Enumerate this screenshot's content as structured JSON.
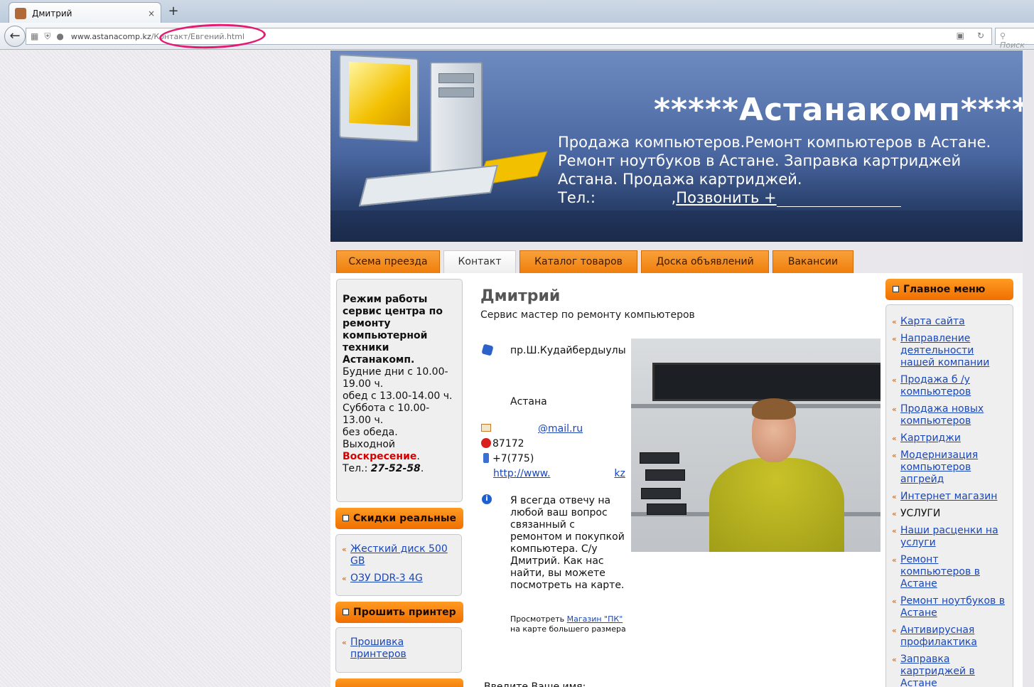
{
  "browser": {
    "tab_title": "Дмитрий",
    "tab_close": "×",
    "new_tab": "+",
    "url_host": "www.astanacomp.kz",
    "url_path": "/Контакт/Евгений.html",
    "search_placeholder": "Поиск"
  },
  "header": {
    "site_title": "*****Астанакомп*****",
    "desc_line1": "Продажа компьютеров.Ремонт компьютеров в Астане.",
    "desc_line2": "Ремонт ноутбуков в Астане. Заправка картриджей",
    "desc_line3": "Астана. Продажа картриджей.",
    "tel_label": "Тел.:",
    "call_link": "Позвонить +"
  },
  "nav": {
    "tabs": [
      {
        "label": "Схема преезда"
      },
      {
        "label": "Контакт"
      },
      {
        "label": "Каталог товаров"
      },
      {
        "label": "Доска объявлений"
      },
      {
        "label": "Вакансии"
      }
    ]
  },
  "left": {
    "hours_title": "Режим работы сервис центра по ремонту компьютерной техники Астанакомп.",
    "weekdays": "Будние дни с 10.00-19.00 ч.",
    "lunch": "обед с 13.00-14.00 ч.",
    "saturday": "Суббота с 10.00-13.00 ч.",
    "no_lunch": "без обеда.",
    "dayoff_label": "Выходной",
    "dayoff_value": "Воскресение",
    "tel_label": "Тел.:",
    "tel_value": "27-52-58",
    "discounts_title": "Скидки реальные",
    "discounts": [
      "Жесткий диск 500 GB",
      "ОЗУ DDR-3 4G"
    ],
    "printer_title": "Прошить принтер",
    "printer_links": [
      "Прошивка принтеров"
    ]
  },
  "contact": {
    "name": "Дмитрий",
    "role": "Сервис мастер по ремонту компьютеров",
    "street": "пр.Ш.Кудайбердыулы",
    "city": "Астана",
    "email_suffix": "@mail.ru",
    "phone1": "87172",
    "phone2": "+7(775)",
    "web_prefix": "http://www.",
    "web_suffix": "kz",
    "about": "Я всегда отвечу на любой ваш вопрос связанный с ремонтом и покупкой компьютера. С/у Дмитрий. Как нас найти, вы можете посмотреть на карте.",
    "map_prefix": "Просмотреть",
    "map_link": "Магазин \"ПК\"",
    "map_suffix": "на карте большего размера",
    "form_label": "Введите Ваше имя:"
  },
  "right": {
    "menu_title": "Главное меню",
    "items": [
      {
        "label": "Карта сайта",
        "link": true
      },
      {
        "label": "Направление деятельности нашей компании",
        "link": true
      },
      {
        "label": "Продажа б /у компьютеров",
        "link": true
      },
      {
        "label": "Продажа новых компьютеров",
        "link": true
      },
      {
        "label": "Картриджи",
        "link": true
      },
      {
        "label": "Модернизация компьютеров апгрейд",
        "link": true
      },
      {
        "label": "Интернет магазин",
        "link": true
      },
      {
        "label": "УСЛУГИ",
        "link": false
      },
      {
        "label": "Наши расценки на услуги",
        "link": true
      },
      {
        "label": "Ремонт компьютеров в Астане",
        "link": true
      },
      {
        "label": "Ремонт ноутбуков в Астане",
        "link": true
      },
      {
        "label": "Антивирусная профилактика",
        "link": true
      },
      {
        "label": "Заправка картриджей в Астане",
        "link": true
      }
    ]
  }
}
